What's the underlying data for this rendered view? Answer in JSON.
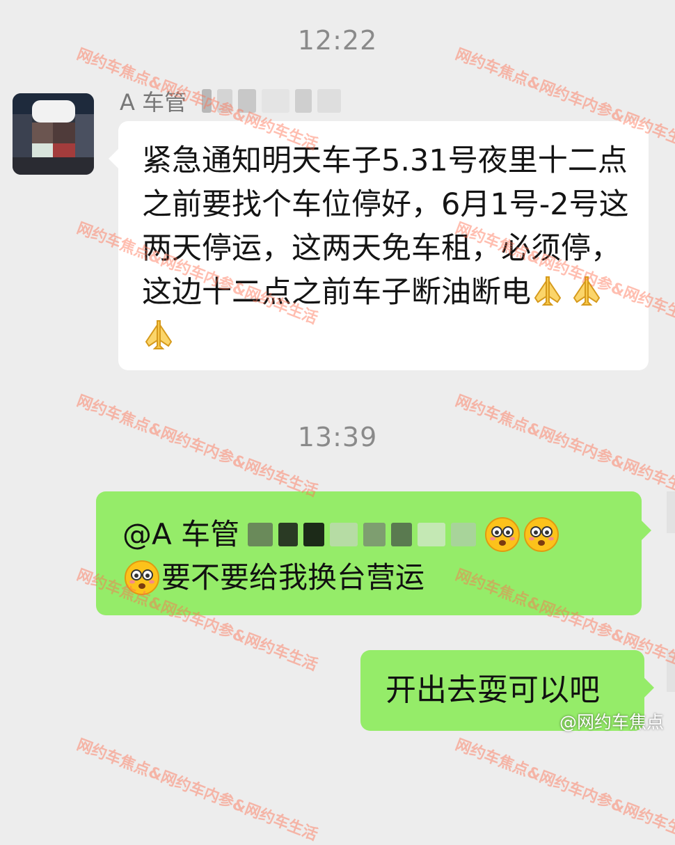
{
  "timestamps": {
    "first": "12:22",
    "second": "13:39"
  },
  "incoming": {
    "sender_name": "A 车管",
    "message_text": "紧急通知明天车子5.31号夜里十二点之前要找个车位停好，6月1号-2号这两天停运，这两天免车租，必须停，这边十二点之前车子断油断电"
  },
  "outgoing": [
    {
      "mention": "@A 车管",
      "text": "要不要给我换台营运"
    },
    {
      "text": "开出去耍可以吧"
    }
  ],
  "watermark": {
    "text": "网约车焦点&网约车内参&网约车生活"
  },
  "footer": {
    "source": "@网约车焦点"
  },
  "colors": {
    "background": "#ededed",
    "incoming_bubble": "#ffffff",
    "outgoing_bubble": "#95ec69",
    "watermark": "#ff6e50"
  }
}
